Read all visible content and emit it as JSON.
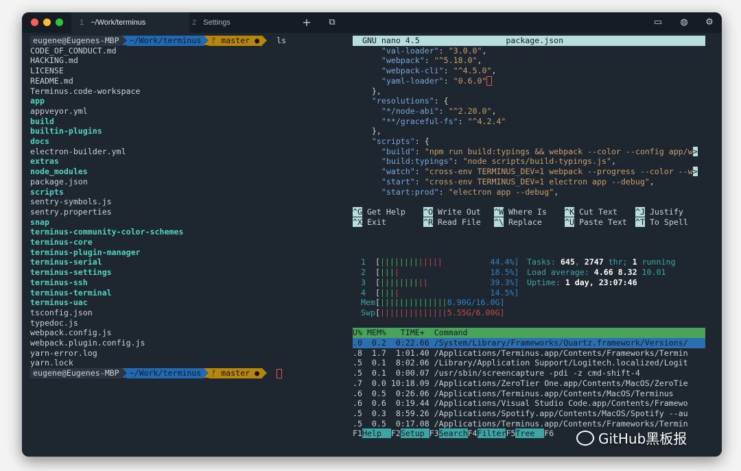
{
  "titlebar": {
    "tabs": [
      {
        "num": "1",
        "label": "~/Work/terminus"
      },
      {
        "num": "2",
        "label": "Settings"
      }
    ],
    "new_tab_glyph": "+",
    "icons": [
      "new-tab-icon",
      "window-icon",
      "keyboard-icon",
      "globe-icon",
      "gear-icon"
    ],
    "traffic_colors": [
      "#ff5f57",
      "#febc2e",
      "#28c840"
    ]
  },
  "left": {
    "prompt": {
      "user": "eugene@Eugenes-MBP",
      "path": "~/Work/terminus",
      "git": "ᚠ master ●",
      "cmd": "ls"
    },
    "files": [
      {
        "name": "CODE_OF_CONDUCT.md",
        "dir": false
      },
      {
        "name": "HACKING.md",
        "dir": false
      },
      {
        "name": "LICENSE",
        "dir": false
      },
      {
        "name": "README.md",
        "dir": false
      },
      {
        "name": "Terminus.code-workspace",
        "dir": false
      },
      {
        "name": "app",
        "dir": true
      },
      {
        "name": "appveyor.yml",
        "dir": false
      },
      {
        "name": "build",
        "dir": true
      },
      {
        "name": "builtin-plugins",
        "dir": true
      },
      {
        "name": "docs",
        "dir": true
      },
      {
        "name": "electron-builder.yml",
        "dir": false
      },
      {
        "name": "extras",
        "dir": true
      },
      {
        "name": "node_modules",
        "dir": true
      },
      {
        "name": "package.json",
        "dir": false
      },
      {
        "name": "scripts",
        "dir": true
      },
      {
        "name": "sentry-symbols.js",
        "dir": false
      },
      {
        "name": "sentry.properties",
        "dir": false
      },
      {
        "name": "snap",
        "dir": true
      },
      {
        "name": "terminus-community-color-schemes",
        "dir": true
      },
      {
        "name": "terminus-core",
        "dir": true
      },
      {
        "name": "terminus-plugin-manager",
        "dir": true
      },
      {
        "name": "terminus-serial",
        "dir": true
      },
      {
        "name": "terminus-settings",
        "dir": true
      },
      {
        "name": "terminus-ssh",
        "dir": true
      },
      {
        "name": "terminus-terminal",
        "dir": true
      },
      {
        "name": "terminus-uac",
        "dir": true
      },
      {
        "name": "tsconfig.json",
        "dir": false
      },
      {
        "name": "typedoc.js",
        "dir": false
      },
      {
        "name": "webpack.config.js",
        "dir": false
      },
      {
        "name": "webpack.plugin.config.js",
        "dir": false
      },
      {
        "name": "yarn-error.log",
        "dir": false
      },
      {
        "name": "yarn.lock",
        "dir": false
      }
    ]
  },
  "nano": {
    "version": "GNU nano 4.5",
    "file": "package.json",
    "lines": [
      {
        "indent": "    ",
        "key": "\"val-loader\"",
        "sep": ": ",
        "val": "\"3.0.0\"",
        "end": ","
      },
      {
        "indent": "    ",
        "key": "\"webpack\"",
        "sep": ": ",
        "val": "\"^5.18.0\"",
        "end": ","
      },
      {
        "indent": "    ",
        "key": "\"webpack-cli\"",
        "sep": ": ",
        "val": "\"^4.5.0\"",
        "end": ","
      },
      {
        "indent": "    ",
        "key": "\"yaml-loader\"",
        "sep": ": ",
        "val": "\"0.6.0\"",
        "end": ""
      },
      {
        "indent": "  ",
        "key": "",
        "sep": "",
        "val": "",
        "end": "},"
      },
      {
        "indent": "  ",
        "key": "\"resolutions\"",
        "sep": ": ",
        "val": "",
        "end": "{"
      },
      {
        "indent": "    ",
        "key": "\"*/node-abi\"",
        "sep": ": ",
        "val": "\"^2.20.0\"",
        "end": ","
      },
      {
        "indent": "    ",
        "key": "\"**/graceful-fs\"",
        "sep": ": ",
        "val": "\"^4.2.4\"",
        "end": ""
      },
      {
        "indent": "  ",
        "key": "",
        "sep": "",
        "val": "",
        "end": "},"
      },
      {
        "indent": "  ",
        "key": "\"scripts\"",
        "sep": ": ",
        "val": "",
        "end": "{"
      },
      {
        "indent": "    ",
        "key": "\"build\"",
        "sep": ": ",
        "val": "\"npm run build:typings && webpack --color --config app/w",
        "end": ">"
      },
      {
        "indent": "    ",
        "key": "\"build:typings\"",
        "sep": ": ",
        "val": "\"node scripts/build-typings.js\"",
        "end": ","
      },
      {
        "indent": "    ",
        "key": "\"watch\"",
        "sep": ": ",
        "val": "\"cross-env TERMINUS_DEV=1 webpack --progress --color --w",
        "end": ">"
      },
      {
        "indent": "    ",
        "key": "\"start\"",
        "sep": ": ",
        "val": "\"cross-env TERMINUS_DEV=1 electron app --debug\"",
        "end": ","
      },
      {
        "indent": "    ",
        "key": "\"start:prod\"",
        "sep": ": ",
        "val": "\"electron app --debug\"",
        "end": ","
      }
    ],
    "shortcuts_row1": [
      {
        "k": "^G",
        "label": "Get Help"
      },
      {
        "k": "^O",
        "label": "Write Out"
      },
      {
        "k": "^W",
        "label": "Where Is"
      },
      {
        "k": "^K",
        "label": "Cut Text"
      },
      {
        "k": "^J",
        "label": "Justify"
      }
    ],
    "shortcuts_row2": [
      {
        "k": "^X",
        "label": "Exit"
      },
      {
        "k": "^R",
        "label": "Read File"
      },
      {
        "k": "^\\",
        "label": "Replace"
      },
      {
        "k": "^U",
        "label": "Paste Text"
      },
      {
        "k": "^T",
        "label": "To Spell"
      }
    ]
  },
  "htop": {
    "cpus": [
      {
        "id": "1",
        "green": "||||||||",
        "red": "|||||",
        "pct": "44.4%]",
        "pad": "          "
      },
      {
        "id": "2",
        "green": "|||",
        "red": "|",
        "pct": "18.5%]",
        "pad": "                   "
      },
      {
        "id": "3",
        "green": "||||||||",
        "red": "||",
        "pct": "39.3%]",
        "pad": "             "
      },
      {
        "id": "4",
        "green": "|||",
        "red": "|",
        "pct": "14.5%]",
        "pad": "                   "
      }
    ],
    "mem": {
      "label": "Mem",
      "bar": "||||||||||||||",
      "value": "8.90G/16.0G]"
    },
    "swp": {
      "label": "Swp",
      "bar": "||||||||||||||",
      "value": "5.55G/6.00G]"
    },
    "tasks_label": "Tasks: ",
    "tasks": "645",
    "thr_sep": ", ",
    "thr": "2747",
    "thr_label": " thr; ",
    "running": "1",
    "running_label": " running",
    "load_label": "Load average: ",
    "load1": "4.66",
    "load5": "8.32",
    "load15": "10.01",
    "uptime_label": "Uptime: ",
    "uptime": "1 day, 23:07:46",
    "proc_header": "U% MEM%   TIME+  Command",
    "procs": [
      ".0  0.2  0:22.66 /System/Library/Frameworks/Quartz.framework/Versions/",
      ".8  1.7  1:01.40 /Applications/Terminus.app/Contents/Frameworks/Termin",
      ".5  0.1  8:02.06 /Library/Application Support/Logitech.localized/Logit",
      ".5  0.1  0:00.07 /usr/sbin/screencapture -pdi -z cmd-shift-4",
      ".7  0.0 10:18.09 /Applications/ZeroTier One.app/Contents/MacOS/ZeroTie",
      ".6  0.5  0:26.06 /Applications/Terminus.app/Contents/MacOS/Terminus",
      ".6  0.6  0:19.44 /Applications/Visual Studio Code.app/Contents/Framewo",
      ".5  0.3  8:59.26 /Applications/Spotify.app/Contents/MacOS/Spotify --au",
      ".5  0.5  0:17.08 /Applications/Terminus.app/Contents/Frameworks/Termin"
    ],
    "fkeys": [
      {
        "k": "F1",
        "label": "Help  "
      },
      {
        "k": "F2",
        "label": "Setup "
      },
      {
        "k": "F3",
        "label": "Search"
      },
      {
        "k": "F4",
        "label": "Filter"
      },
      {
        "k": "F5",
        "label": "Tree  "
      },
      {
        "k": "F6",
        "label": ""
      }
    ]
  },
  "watermark": "GitHub黑板报"
}
